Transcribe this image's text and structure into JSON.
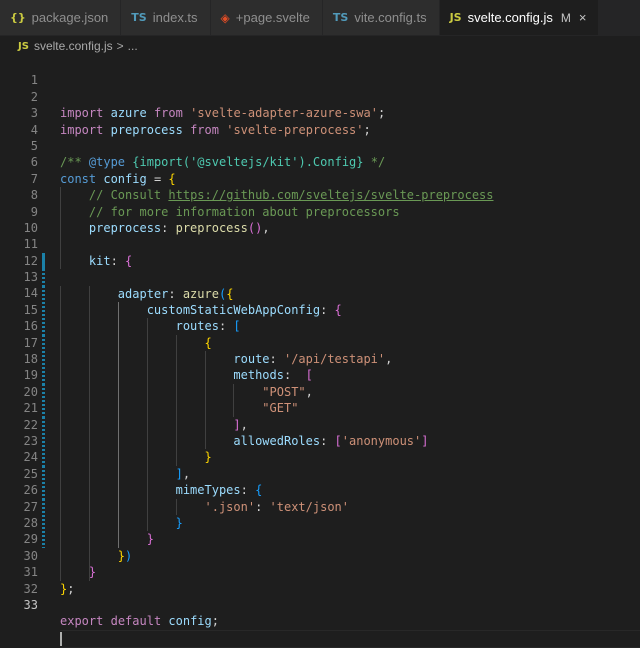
{
  "tabs": [
    {
      "icon": "{}",
      "label": "package.json"
    },
    {
      "icon": "TS",
      "label": "index.ts"
    },
    {
      "icon": "◈",
      "label": "+page.svelte"
    },
    {
      "icon": "TS",
      "label": "vite.config.ts"
    },
    {
      "icon": "JS",
      "label": "svelte.config.js",
      "modified": "M",
      "close": "×"
    }
  ],
  "breadcrumb": {
    "icon": "JS",
    "file": "svelte.config.js",
    "sep": ">",
    "more": "..."
  },
  "editor": {
    "line_numbers": [
      "1",
      "2",
      "3",
      "4",
      "5",
      "6",
      "7",
      "8",
      "9",
      "10",
      "11",
      "12",
      "13",
      "14",
      "15",
      "16",
      "17",
      "18",
      "19",
      "20",
      "21",
      "22",
      "23",
      "24",
      "25",
      "26",
      "27",
      "28",
      "29",
      "30",
      "31",
      "32",
      "33"
    ],
    "code": {
      "l1": {
        "kw": "import",
        "id": "azure",
        "from": "from",
        "str": "'svelte-adapter-azure-swa'",
        "semi": ";"
      },
      "l2": {
        "kw": "import",
        "id": "preprocess",
        "from": "from",
        "str": "'svelte-preprocess'",
        "semi": ";"
      },
      "l4": {
        "open": "/** ",
        "tag": "@type",
        "type_open": "{",
        "imp": "import",
        "arg": "('@sveltejs/kit')",
        "dot": ".",
        "cfg": "Config",
        "type_close": "}",
        "close": " */"
      },
      "l5": {
        "kw": "const",
        "id": "config",
        "eq": " = ",
        "brace": "{"
      },
      "l6": {
        "text": "// Consult ",
        "link": "https://github.com/sveltejs/svelte-preprocess"
      },
      "l7": {
        "text": "// for more information about preprocessors"
      },
      "l8": {
        "key": "preprocess",
        "colon": ": ",
        "fn": "preprocess",
        "paren": "()",
        "comma": ","
      },
      "l10": {
        "key": "kit",
        "colon": ": ",
        "brace": "{"
      },
      "l11": {
        "key": "adapter",
        "colon": ": ",
        "fn": "azure",
        "paren": "(",
        "brace": "{"
      },
      "l12": {
        "key": "customStaticWebAppConfig",
        "colon": ": ",
        "brace": "{"
      },
      "l13": {
        "key": "routes",
        "colon": ": ",
        "bracket": "["
      },
      "l14": {
        "brace": "{"
      },
      "l15": {
        "key": "route",
        "colon": ": ",
        "str": "'/api/testapi'",
        "comma": ","
      },
      "l16": {
        "key": "methods",
        "colon": ":  ",
        "bracket": "["
      },
      "l17": {
        "str": "\"POST\"",
        "comma": ","
      },
      "l18": {
        "str": "\"GET\""
      },
      "l19": {
        "bracket": "]",
        "comma": ","
      },
      "l20": {
        "key": "allowedRoles",
        "colon": ": ",
        "open": "[",
        "str": "'anonymous'",
        "close": "]"
      },
      "l21": {
        "brace": "}"
      },
      "l22": {
        "bracket": "]",
        "comma": ","
      },
      "l23": {
        "key": "mimeTypes",
        "colon": ": ",
        "brace": "{"
      },
      "l24": {
        "str1": "'.json'",
        "colon": ": ",
        "str2": "'text/json'"
      },
      "l25": {
        "brace": "}"
      },
      "l26": {
        "brace": "}"
      },
      "l27": {
        "brace": "}",
        "paren": ")"
      },
      "l29": {
        "brace": "}"
      },
      "l30": {
        "brace": "}",
        "semi": ";"
      },
      "l32": {
        "kw1": "export",
        "kw2": "default",
        "id": "config",
        "semi": ";"
      }
    }
  },
  "colors": {
    "background": "#1e1e1e",
    "tab_inactive": "#2d2d2d",
    "keyword": "#569cd6",
    "control_keyword": "#c586c0",
    "variable": "#9cdcfe",
    "string": "#ce9178",
    "comment": "#6a9955",
    "function": "#dcdcaa",
    "type": "#4ec9b0",
    "bracket_1": "#ffd700",
    "bracket_2": "#da70d6",
    "bracket_3": "#179fff",
    "git_modified": "#1b81a8"
  }
}
